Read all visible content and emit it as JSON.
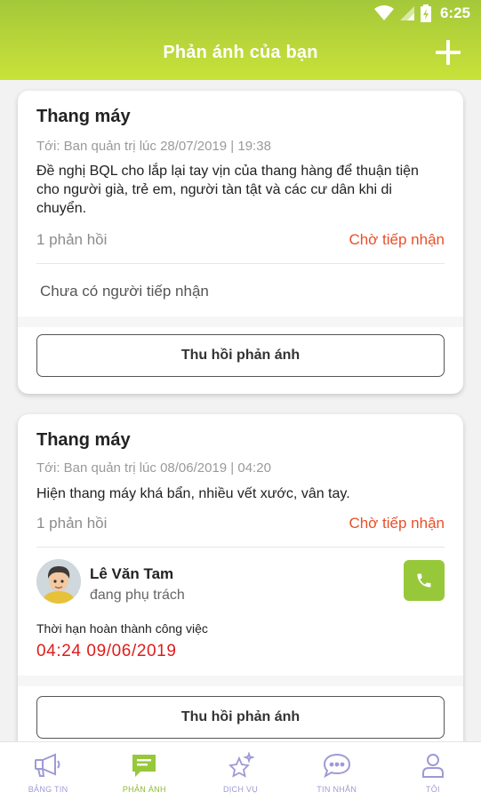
{
  "status_bar": {
    "time": "6:25"
  },
  "header": {
    "title": "Phản ánh của bạn"
  },
  "cards": [
    {
      "title": "Thang máy",
      "meta": "Tới: Ban quản trị lúc 28/07/2019 | 19:38",
      "body": "Đề nghị BQL cho lắp lại tay vịn của thang hàng để thuận tiện cho người già, trẻ em, người tàn tật và các cư dân khi di chuyển.",
      "replies": "1 phản hồi",
      "status": "Chờ tiếp nhận",
      "handler_note": "Chưa có người tiếp nhận",
      "action_label": "Thu hồi phản ánh"
    },
    {
      "title": "Thang máy",
      "meta": "Tới: Ban quản trị lúc 08/06/2019 | 04:20",
      "body": "Hiện thang máy khá bẩn, nhiều vết xước, vân tay.",
      "replies": "1 phản hồi",
      "status": "Chờ tiếp nhận",
      "assignee": {
        "name": "Lê Văn Tam",
        "role": "đang phụ trách"
      },
      "deadline_label": "Thời hạn hoàn thành công việc",
      "deadline_value": "04:24 09/06/2019",
      "action_label": "Thu hồi phản ánh"
    }
  ],
  "bottom_nav": [
    {
      "label": "BẢNG TIN",
      "icon": "megaphone-icon",
      "active": false
    },
    {
      "label": "PHẢN ÁNH",
      "icon": "chat-note-icon",
      "active": true
    },
    {
      "label": "DỊCH VỤ",
      "icon": "sparkle-star-icon",
      "active": false
    },
    {
      "label": "TIN NHẮN",
      "icon": "chat-bubble-icon",
      "active": false
    },
    {
      "label": "TÔI",
      "icon": "user-icon",
      "active": false
    }
  ],
  "colors": {
    "header_gradient_start": "#a4c83a",
    "header_gradient_end": "#c9e23a",
    "status_pending": "#e8502a",
    "deadline": "#e01b1b",
    "accent_green": "#97c83a",
    "nav_inactive": "#9e9ad6"
  }
}
